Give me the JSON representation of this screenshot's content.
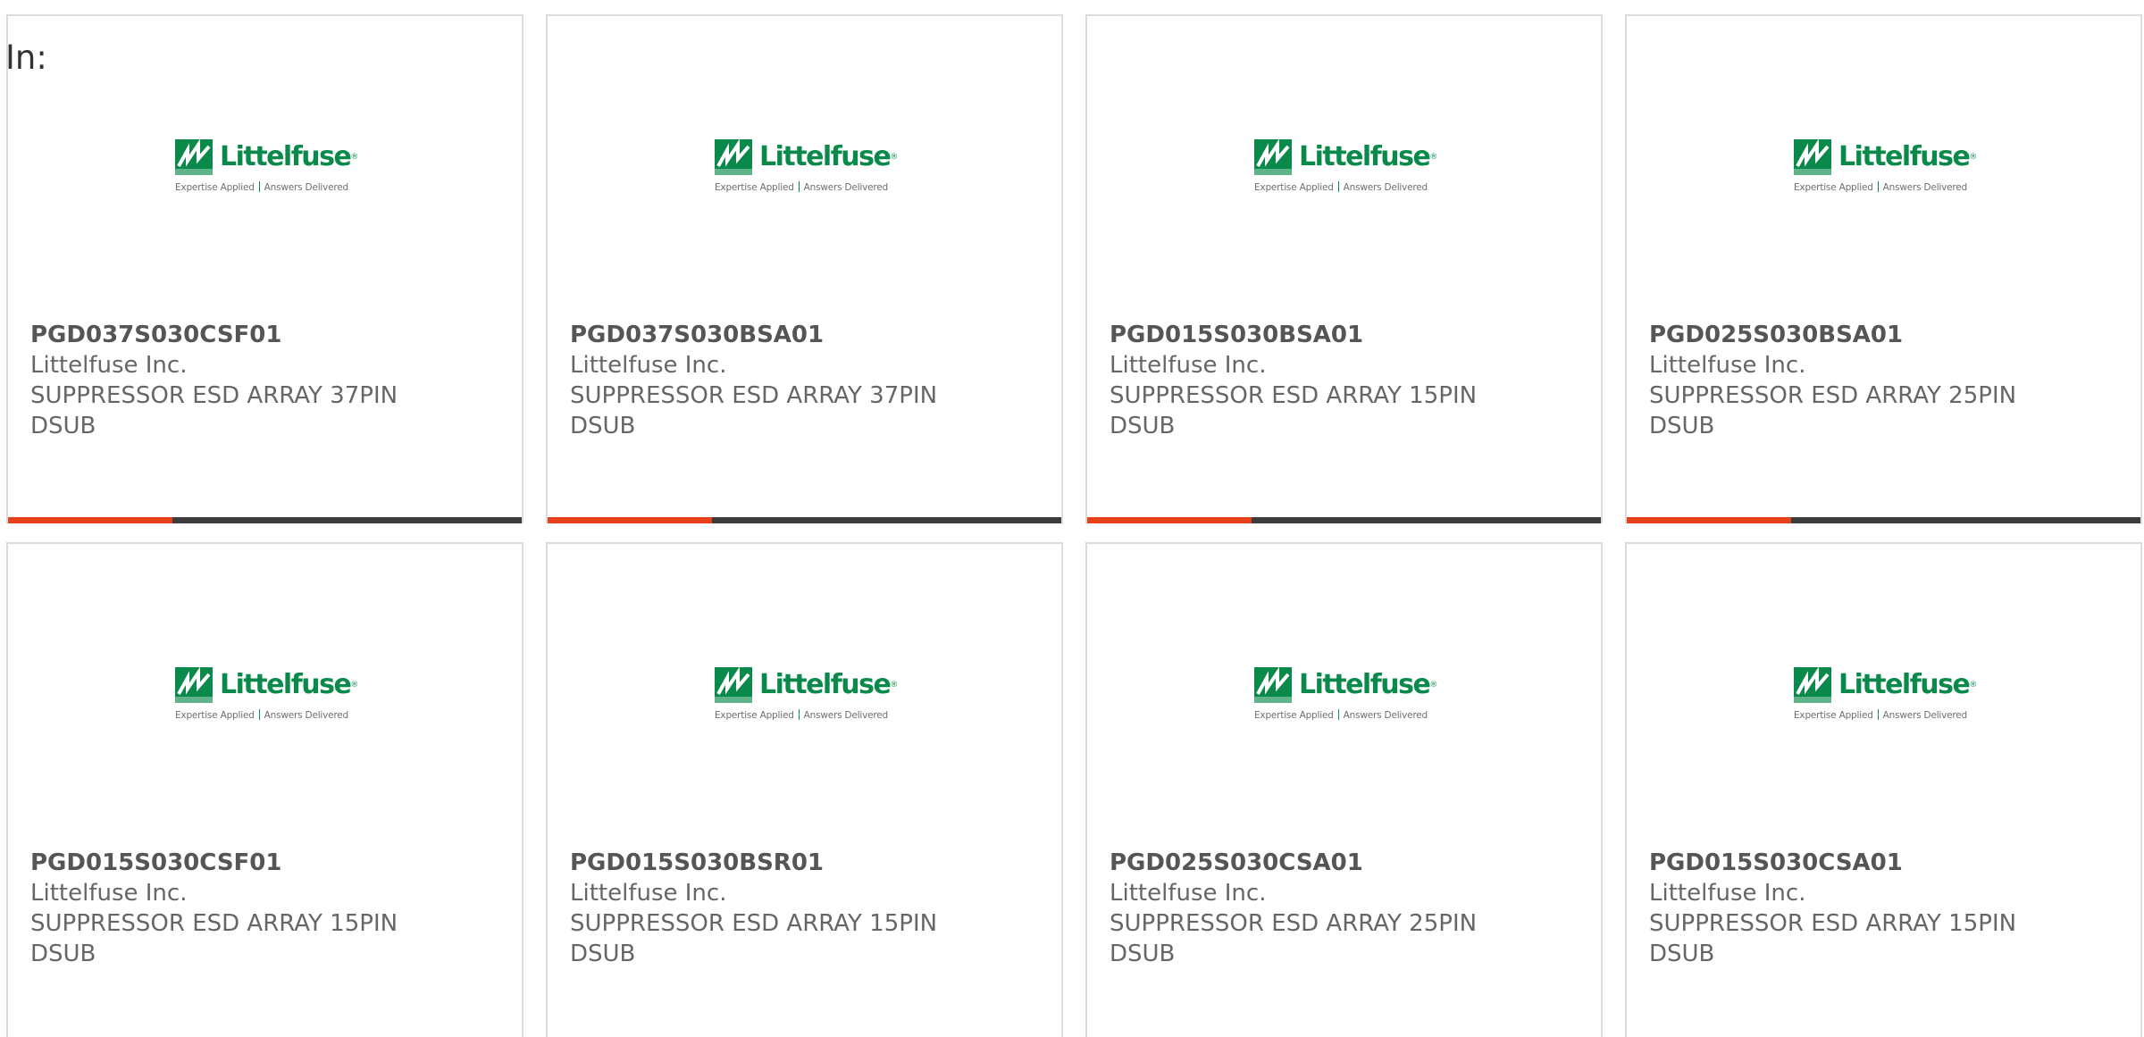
{
  "filter_label": "In:",
  "brand": {
    "name": "Littelfuse",
    "tagline_left": "Expertise Applied",
    "tagline_right": "Answers Delivered",
    "green": "#0a8a4a",
    "accent": "#e8401a",
    "bar": "#3c3c3c"
  },
  "products": [
    {
      "part": "PGD037S030CSF01",
      "manufacturer": "Littelfuse Inc.",
      "description": "SUPPRESSOR ESD ARRAY 37PIN DSUB"
    },
    {
      "part": "PGD037S030BSA01",
      "manufacturer": "Littelfuse Inc.",
      "description": "SUPPRESSOR ESD ARRAY 37PIN DSUB"
    },
    {
      "part": "PGD015S030BSA01",
      "manufacturer": "Littelfuse Inc.",
      "description": "SUPPRESSOR ESD ARRAY 15PIN DSUB"
    },
    {
      "part": "PGD025S030BSA01",
      "manufacturer": "Littelfuse Inc.",
      "description": "SUPPRESSOR ESD ARRAY 25PIN DSUB"
    },
    {
      "part": "PGD015S030CSF01",
      "manufacturer": "Littelfuse Inc.",
      "description": "SUPPRESSOR ESD ARRAY 15PIN DSUB"
    },
    {
      "part": "PGD015S030BSR01",
      "manufacturer": "Littelfuse Inc.",
      "description": "SUPPRESSOR ESD ARRAY 15PIN DSUB"
    },
    {
      "part": "PGD025S030CSA01",
      "manufacturer": "Littelfuse Inc.",
      "description": "SUPPRESSOR ESD ARRAY 25PIN DSUB"
    },
    {
      "part": "PGD015S030CSA01",
      "manufacturer": "Littelfuse Inc.",
      "description": "SUPPRESSOR ESD ARRAY 15PIN DSUB"
    }
  ]
}
